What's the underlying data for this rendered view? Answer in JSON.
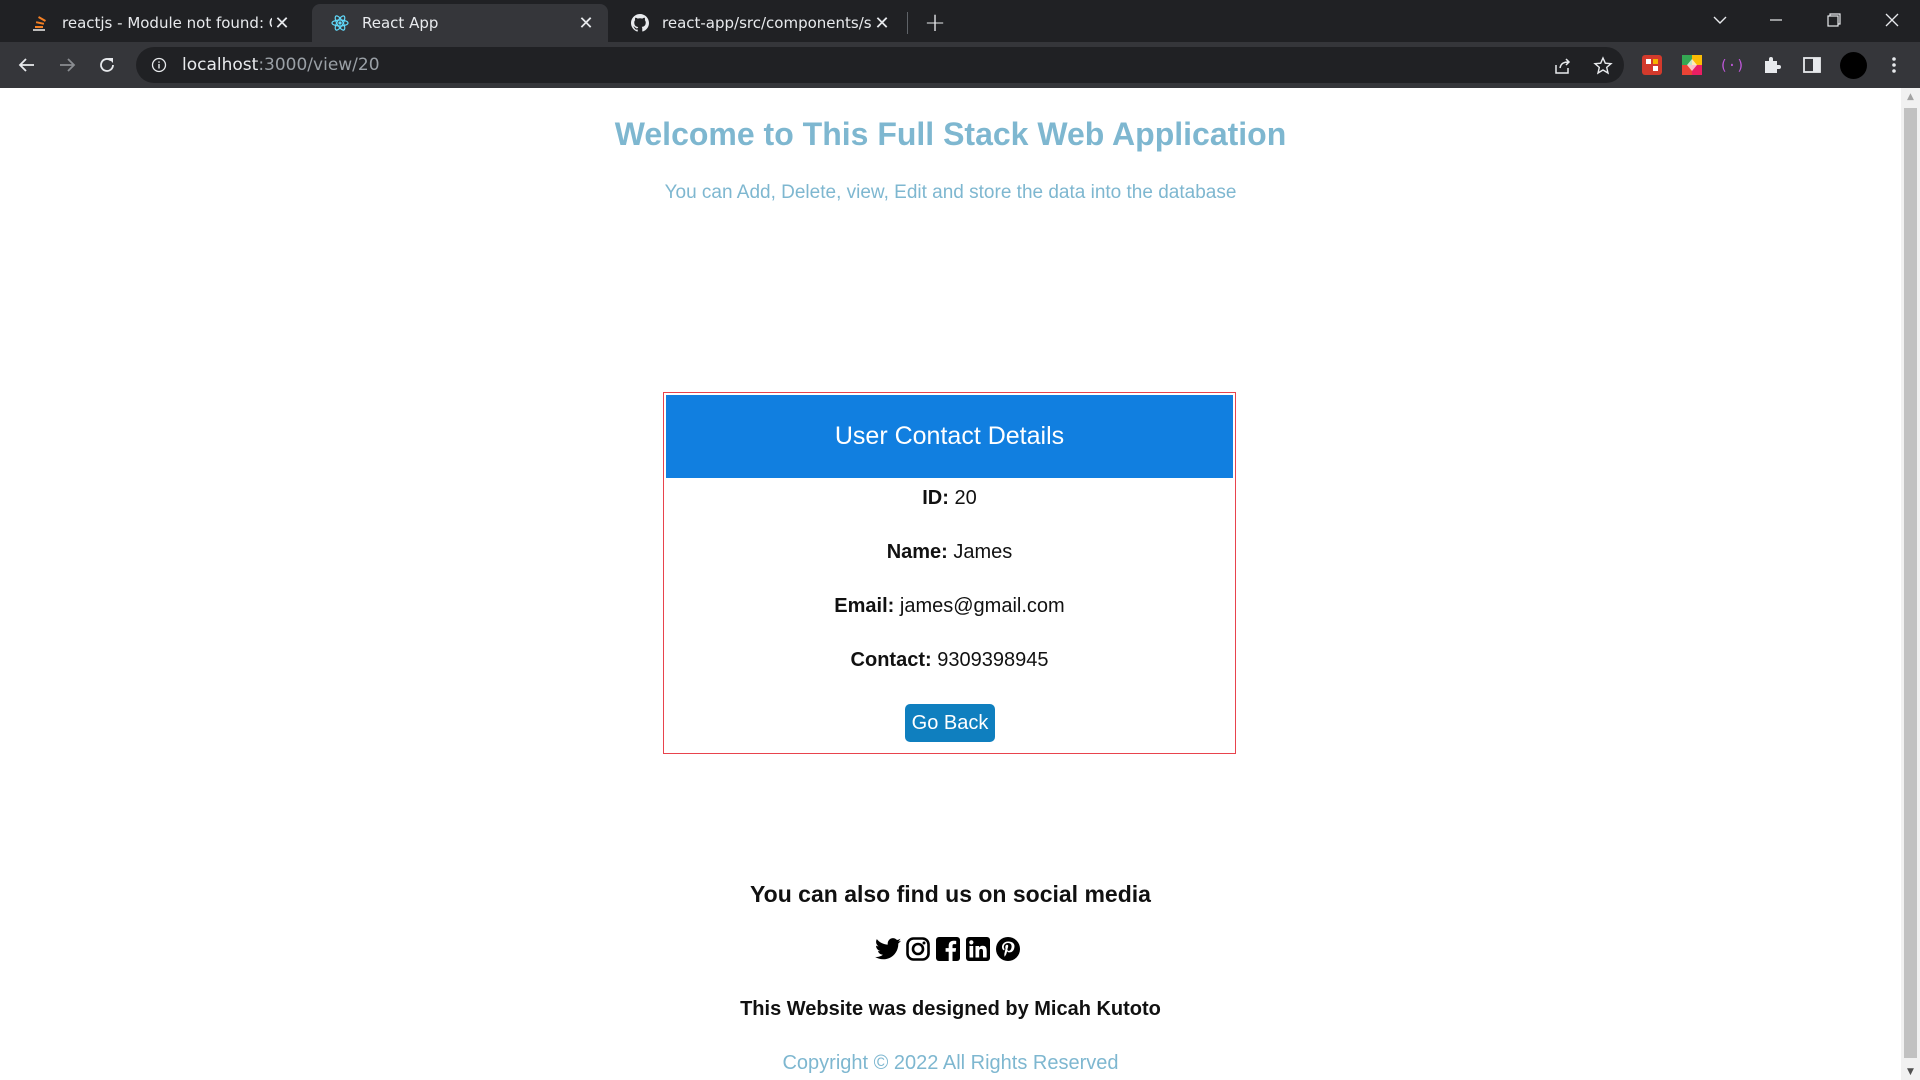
{
  "browser": {
    "tabs": [
      {
        "title": "reactjs - Module not found: Can't",
        "icon": "stackoverflow-icon",
        "active": false
      },
      {
        "title": "React App",
        "icon": "react-icon",
        "active": true
      },
      {
        "title": "react-app/src/components/styles",
        "icon": "github-icon",
        "active": false
      }
    ],
    "url_host": "localhost",
    "url_path": ":3000/view/20"
  },
  "page": {
    "title": "Welcome to This Full Stack Web Application",
    "subtitle": "You can Add, Delete, view, Edit and store the data into the database",
    "card": {
      "header": "User Contact Details",
      "fields": [
        {
          "label": "ID:",
          "value": "20"
        },
        {
          "label": "Name:",
          "value": "James"
        },
        {
          "label": "Email:",
          "value": "james@gmail.com"
        },
        {
          "label": "Contact:",
          "value": "9309398945"
        }
      ],
      "button_label": "Go Back"
    },
    "footer": {
      "social_heading": "You can also find us on social media",
      "social_icons": [
        "twitter-icon",
        "instagram-icon",
        "facebook-icon",
        "linkedin-icon",
        "pinterest-icon"
      ],
      "designed_by": "This Website was designed by Micah Kutoto",
      "copyright": "Copyright © 2022 All Rights Reserved"
    }
  },
  "colors": {
    "accent_text": "#7eb7d0",
    "card_header": "#117fe0",
    "card_border": "#e8434d",
    "button": "#0f7fbf"
  }
}
